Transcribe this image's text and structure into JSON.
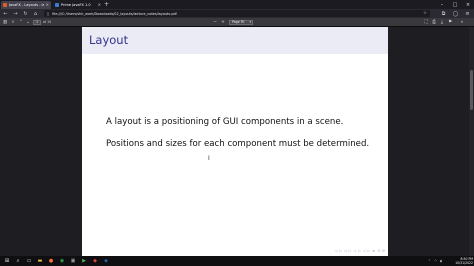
{
  "browser": {
    "tabs": [
      {
        "label": "JavaFX - Layouts - layouts.pdf",
        "active": true,
        "favicon_color": "#e25d2c"
      },
      {
        "label": "Prime JavaFX 1.0",
        "active": false,
        "favicon_color": "#3c7ad9"
      }
    ],
    "new_tab_icon": "plus-icon",
    "window_controls": [
      "minimize-icon",
      "maximize-icon",
      "close-icon"
    ],
    "url": "file:///C:/Users/shir_work/Downloads/02_layouts/lecture_notes/layouts.pdf",
    "nav_icons": [
      "back-icon",
      "forward-icon",
      "reload-icon",
      "home-icon"
    ]
  },
  "pdf_toolbar": {
    "current_page": "1",
    "page_count": "of 15",
    "zoom": "Page Fit",
    "icons": [
      "sidebar-icon",
      "search-icon",
      "prev-page-icon",
      "next-page-icon",
      "zoom-out-icon",
      "zoom-in-icon",
      "presentation-icon",
      "print-icon",
      "download-icon",
      "bookmark-icon",
      "tools-icon"
    ]
  },
  "slide": {
    "title": "Layout",
    "line1": "A layout is a positioning of GUI components in a scene.",
    "line2": "Positions and sizes for each component must be determined.",
    "nav_symbols": [
      "◁",
      "▷",
      "◁",
      "▷",
      "◁",
      "▷",
      "◁",
      "▷",
      "≡",
      "↺",
      "⟳"
    ],
    "title_color": "#33338c",
    "titlebar_color": "#ebebf6"
  },
  "taskbar": {
    "apps": [
      {
        "name": "windows-start-icon",
        "glyph": "⊞",
        "color": "#e8e8ee"
      },
      {
        "name": "search-icon",
        "glyph": "⌕",
        "color": "#e8e8ee"
      },
      {
        "name": "taskview-icon",
        "glyph": "▭",
        "color": "#e8e8ee"
      },
      {
        "name": "file-explorer-icon",
        "glyph": "▬",
        "color": "#f2c14e"
      },
      {
        "name": "firefox-icon",
        "glyph": "●",
        "color": "#ff7139"
      },
      {
        "name": "chrome-icon",
        "glyph": "◉",
        "color": "#34a853"
      },
      {
        "name": "terminal-icon",
        "glyph": "▣",
        "color": "#9aa0a6"
      },
      {
        "name": "media-player-icon",
        "glyph": "▶",
        "color": "#4caf50"
      },
      {
        "name": "app-icon",
        "glyph": "◆",
        "color": "#e04040"
      },
      {
        "name": "code-icon",
        "glyph": "◈",
        "color": "#2d7ad6"
      }
    ],
    "clock_time": "8:50 PM",
    "clock_date": "10/31/2022"
  }
}
